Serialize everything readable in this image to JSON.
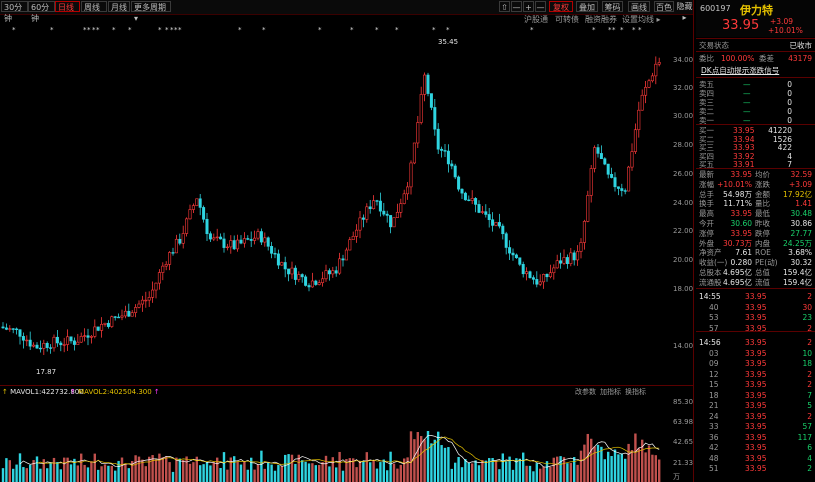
{
  "toolbar": {
    "tabs": [
      "30分钟",
      "60分钟",
      "日线",
      "周线",
      "月线",
      "更多周期 ▾"
    ],
    "active_tab": "日线",
    "tools": [
      "⇧",
      "—",
      "+",
      "—",
      "复权",
      "叠加",
      "筹码",
      "画线",
      "百色"
    ],
    "more_label": "隐藏 ▸"
  },
  "subtabs": [
    "沪股通",
    "可转债",
    "融资融券",
    "设置均线 ▸"
  ],
  "chart_labels": {
    "high_marker": "35.45",
    "low_marker": "17.87",
    "vol_legend_1": "MAVOL1:422732.800",
    "vol_legend_2": "MAVOL2:402504.300",
    "vol_tools": [
      "改参数",
      "加指标",
      "换指标"
    ]
  },
  "price_axis": [
    "34.00",
    "32.00",
    "30.00",
    "28.00",
    "26.00",
    "24.00",
    "22.00",
    "20.00",
    "18.00",
    "14.00"
  ],
  "vol_axis": [
    "85.30",
    "63.98",
    "42.65",
    "21.33"
  ],
  "vol_axis_unit": "万",
  "stock": {
    "code": "600197",
    "name": "伊力特",
    "price": "33.95",
    "change": "+3.09",
    "change_pct": "+10.01%",
    "status_label": "交易状态",
    "status_value": "已收市"
  },
  "ratio": {
    "wb_label": "委比",
    "wb_value": "100.00%",
    "wc_label": "委差",
    "wc_value": "43179"
  },
  "signal_title": "DK点自动提示涨跌信号",
  "asks": [
    {
      "label": "卖五",
      "price": "—",
      "vol": "0"
    },
    {
      "label": "卖四",
      "price": "—",
      "vol": "0"
    },
    {
      "label": "卖三",
      "price": "—",
      "vol": "0"
    },
    {
      "label": "卖二",
      "price": "—",
      "vol": "0"
    },
    {
      "label": "卖一",
      "price": "—",
      "vol": "0"
    }
  ],
  "bids": [
    {
      "label": "买一",
      "price": "33.95",
      "vol": "41220"
    },
    {
      "label": "买二",
      "price": "33.94",
      "vol": "1526"
    },
    {
      "label": "买三",
      "price": "33.93",
      "vol": "422"
    },
    {
      "label": "买四",
      "price": "33.92",
      "vol": "4"
    },
    {
      "label": "买五",
      "price": "33.91",
      "vol": "7"
    }
  ],
  "stats": [
    {
      "l1": "最新",
      "v1": "33.95",
      "c1": "red",
      "l2": "均价",
      "v2": "32.59",
      "c2": "red"
    },
    {
      "l1": "涨幅",
      "v1": "+10.01%",
      "c1": "red",
      "l2": "涨跌",
      "v2": "+3.09",
      "c2": "red"
    },
    {
      "l1": "总手",
      "v1": "54.98万",
      "c1": "white",
      "l2": "金额",
      "v2": "17.92亿",
      "c2": "yellow"
    },
    {
      "l1": "换手",
      "v1": "11.71%",
      "c1": "white",
      "l2": "量比",
      "v2": "1.41",
      "c2": "red"
    },
    {
      "l1": "最高",
      "v1": "33.95",
      "c1": "red",
      "l2": "最低",
      "v2": "30.48",
      "c2": "green"
    },
    {
      "l1": "今开",
      "v1": "30.60",
      "c1": "green",
      "l2": "昨收",
      "v2": "30.86",
      "c2": "white"
    },
    {
      "l1": "涨停",
      "v1": "33.95",
      "c1": "red",
      "l2": "跌停",
      "v2": "27.77",
      "c2": "green"
    },
    {
      "l1": "外盘",
      "v1": "30.73万",
      "c1": "red",
      "l2": "内盘",
      "v2": "24.25万",
      "c2": "green"
    },
    {
      "l1": "净资产",
      "v1": "7.61",
      "c1": "white",
      "l2": "ROE",
      "v2": "3.68%",
      "c2": "white"
    },
    {
      "l1": "收益(一)",
      "v1": "0.280",
      "c1": "white",
      "l2": "PE(动)",
      "v2": "30.32",
      "c2": "white"
    },
    {
      "l1": "总股本",
      "v1": "4.695亿",
      "c1": "white",
      "l2": "总值",
      "v2": "159.4亿",
      "c2": "white"
    },
    {
      "l1": "流通股",
      "v1": "4.695亿",
      "c1": "white",
      "l2": "流值",
      "v2": "159.4亿",
      "c2": "white"
    }
  ],
  "ticks": [
    {
      "t": "14:55",
      "p": "33.95",
      "v": "2",
      "c": "red"
    },
    {
      "t": "40",
      "p": "33.95",
      "v": "30",
      "c": "red"
    },
    {
      "t": "53",
      "p": "33.95",
      "v": "23",
      "c": "green"
    },
    {
      "t": "57",
      "p": "33.95",
      "v": "2",
      "c": "red"
    },
    {
      "t": "14:56",
      "p": "33.95",
      "v": "2",
      "c": "red"
    },
    {
      "t": "03",
      "p": "33.95",
      "v": "10",
      "c": "green"
    },
    {
      "t": "09",
      "p": "33.95",
      "v": "18",
      "c": "green"
    },
    {
      "t": "12",
      "p": "33.95",
      "v": "2",
      "c": "red"
    },
    {
      "t": "15",
      "p": "33.95",
      "v": "2",
      "c": "red"
    },
    {
      "t": "18",
      "p": "33.95",
      "v": "7",
      "c": "green"
    },
    {
      "t": "21",
      "p": "33.95",
      "v": "5",
      "c": "green"
    },
    {
      "t": "24",
      "p": "33.95",
      "v": "2",
      "c": "red"
    },
    {
      "t": "33",
      "p": "33.95",
      "v": "57",
      "c": "green"
    },
    {
      "t": "36",
      "p": "33.95",
      "v": "117",
      "c": "green"
    },
    {
      "t": "42",
      "p": "33.95",
      "v": "6",
      "c": "green"
    },
    {
      "t": "48",
      "p": "33.95",
      "v": "4",
      "c": "green"
    },
    {
      "t": "51",
      "p": "33.95",
      "v": "2",
      "c": "green"
    }
  ],
  "colors": {
    "up": "#ff3a3a",
    "down": "#2fd4e0",
    "vol_up": "#c0504d",
    "vol_down": "#2fd4e0",
    "ma1": "#ffffff",
    "ma2": "#e6c200"
  }
}
